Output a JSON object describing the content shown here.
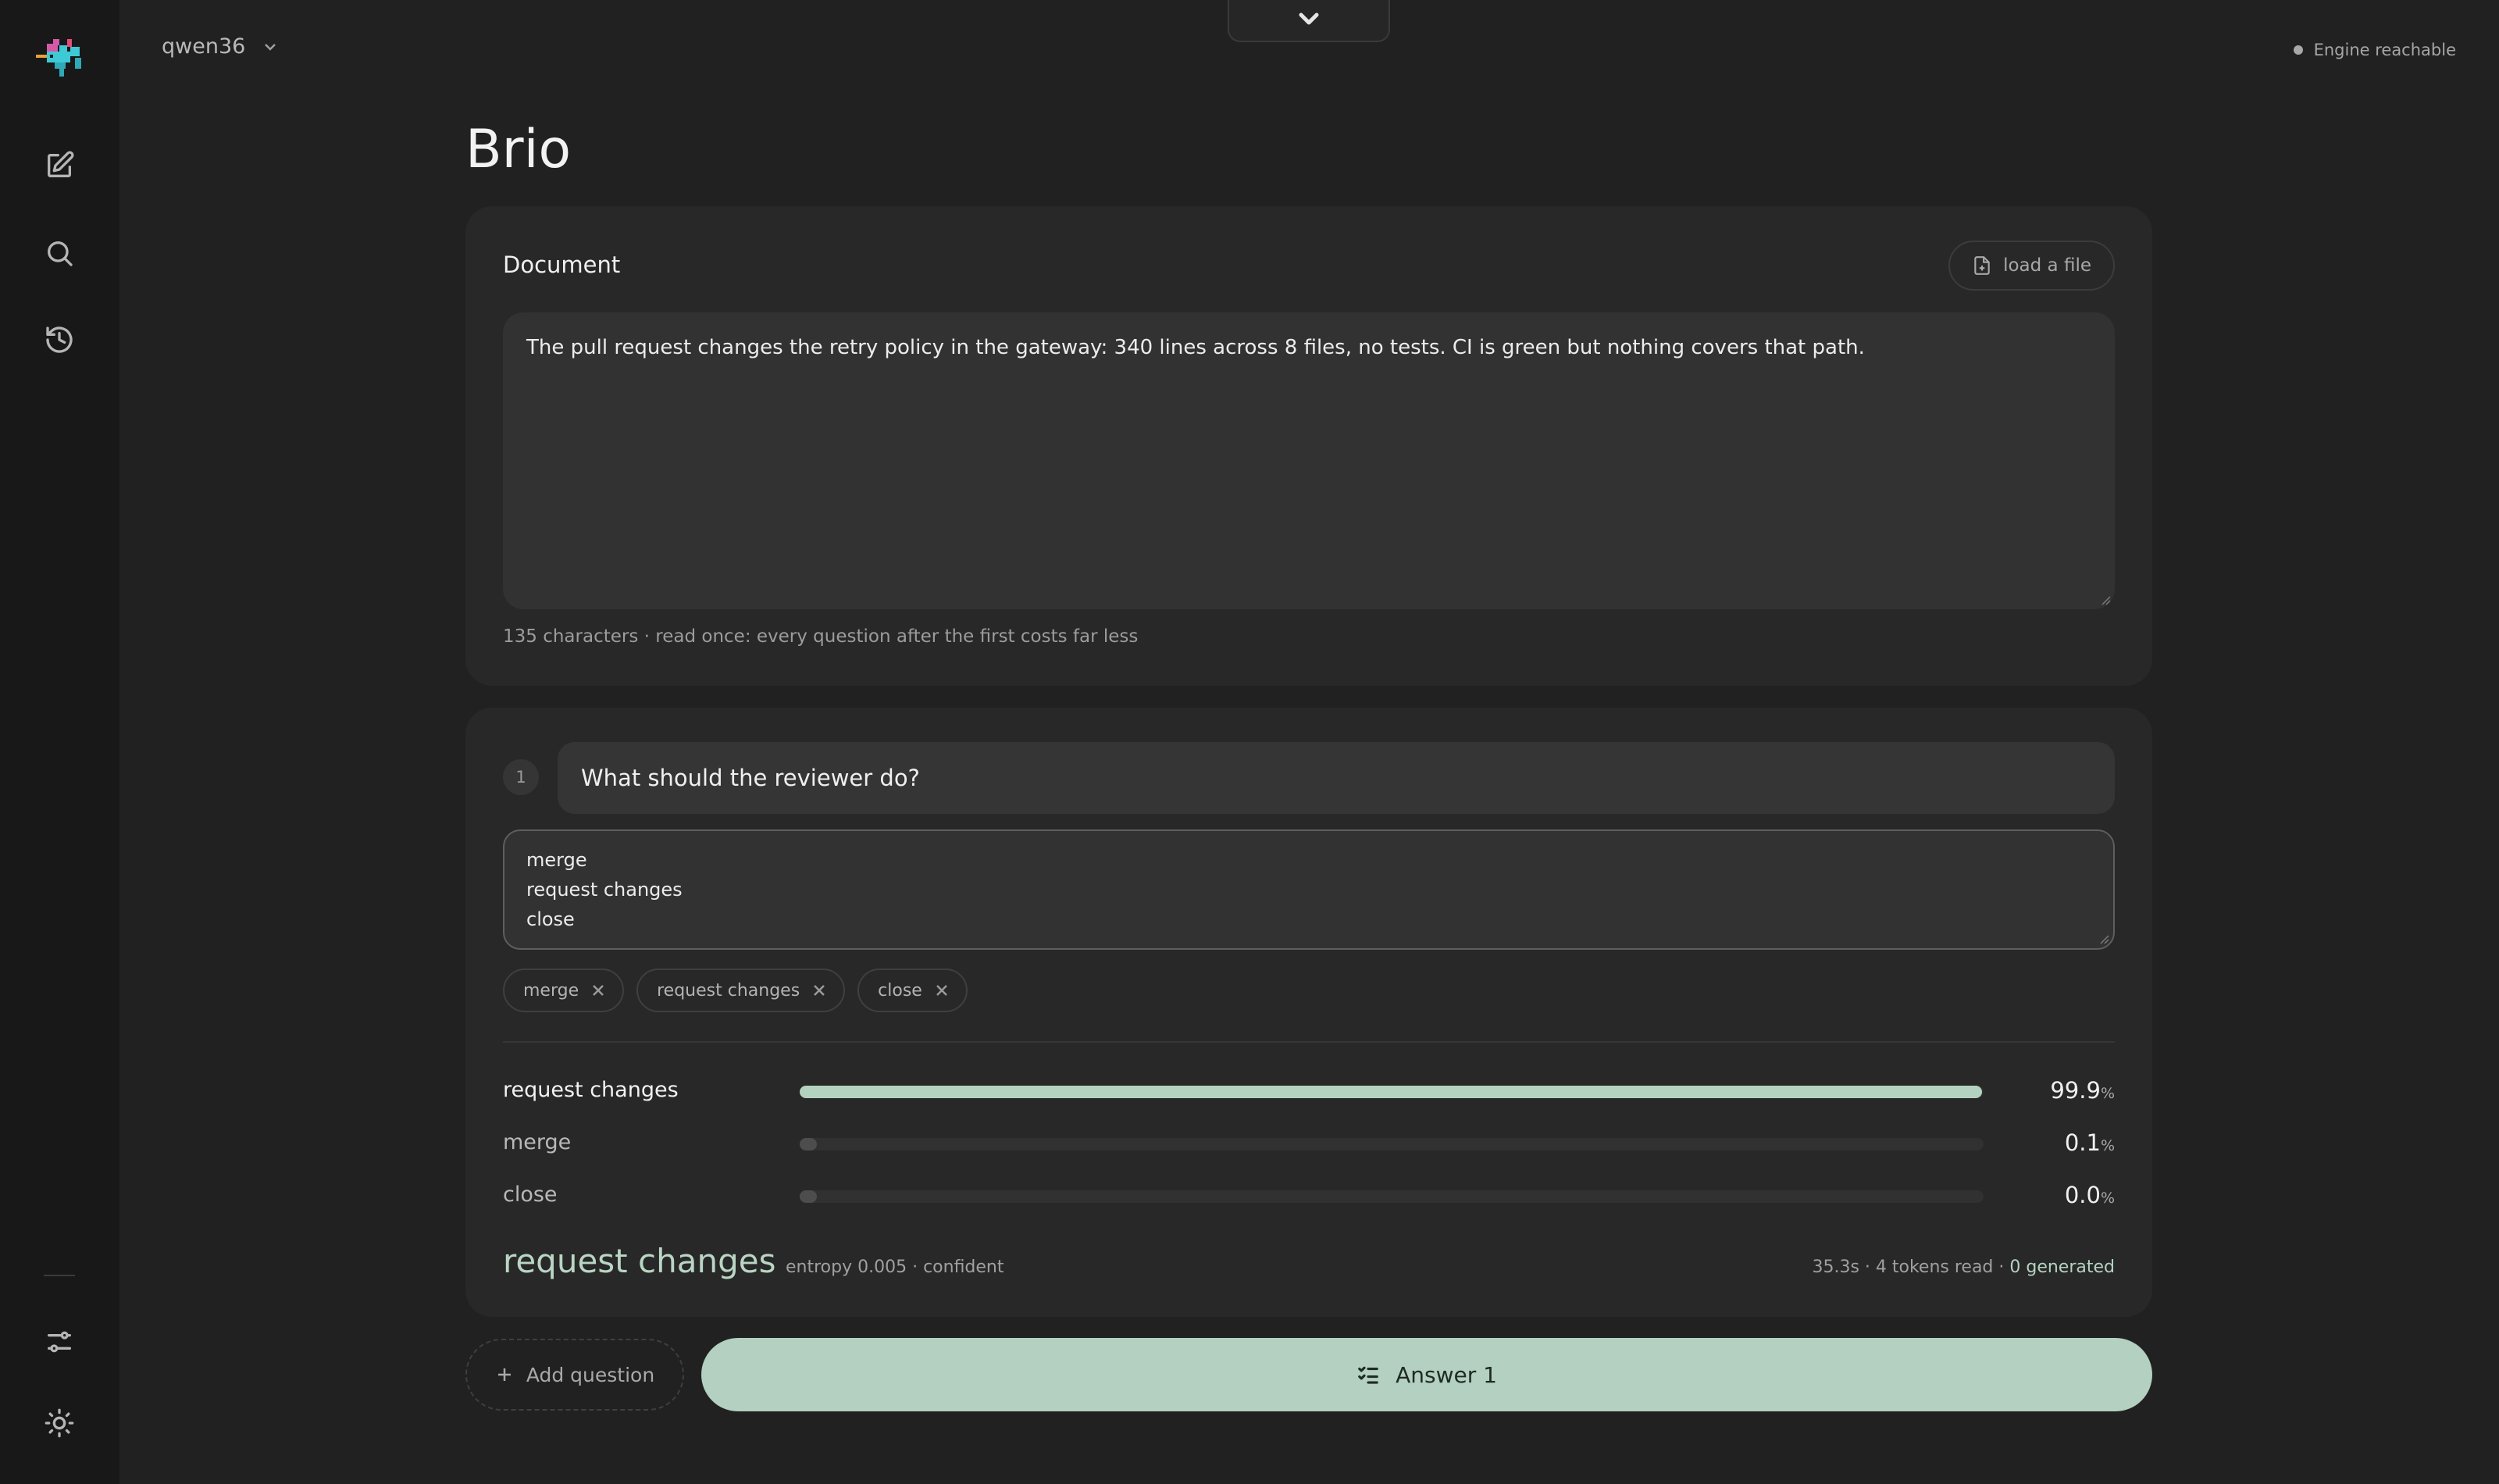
{
  "header": {
    "model_name": "qwen36",
    "status_text": "Engine reachable"
  },
  "sidebar": {
    "items": [
      {
        "name": "new",
        "icon": "edit-icon"
      },
      {
        "name": "search",
        "icon": "search-icon"
      },
      {
        "name": "history",
        "icon": "history-icon"
      },
      {
        "name": "settings",
        "icon": "sliders-icon"
      },
      {
        "name": "theme",
        "icon": "sun-icon"
      }
    ]
  },
  "page": {
    "title": "Brio"
  },
  "document": {
    "label": "Document",
    "load_label": "load a file",
    "text": "The pull request changes the retry policy in the gateway: 340 lines across 8 files, no tests. CI is green but nothing covers that path.",
    "meta": "135 characters · read once: every question after the first costs far less"
  },
  "question": {
    "number": "1",
    "text": "What should the reviewer do?",
    "options": [
      "merge",
      "request changes",
      "close"
    ],
    "chips": [
      "merge",
      "request changes",
      "close"
    ],
    "results": [
      {
        "label": "request changes",
        "pct": "99.9",
        "fraction": 0.999
      },
      {
        "label": "merge",
        "pct": "0.1",
        "fraction": 0.001
      },
      {
        "label": "close",
        "pct": "0.0",
        "fraction": 0.0
      }
    ],
    "pct_unit": "%",
    "answer": "request changes",
    "entropy": "entropy 0.005 · confident",
    "stats_prefix": "35.3s · 4 tokens read · ",
    "stats_generated": "0 generated"
  },
  "actions": {
    "add_question": "Add question",
    "answer": "Answer 1"
  },
  "colors": {
    "accent": "#b3d0c0",
    "background": "#212121",
    "card": "#282828",
    "sidebar": "#181818"
  }
}
